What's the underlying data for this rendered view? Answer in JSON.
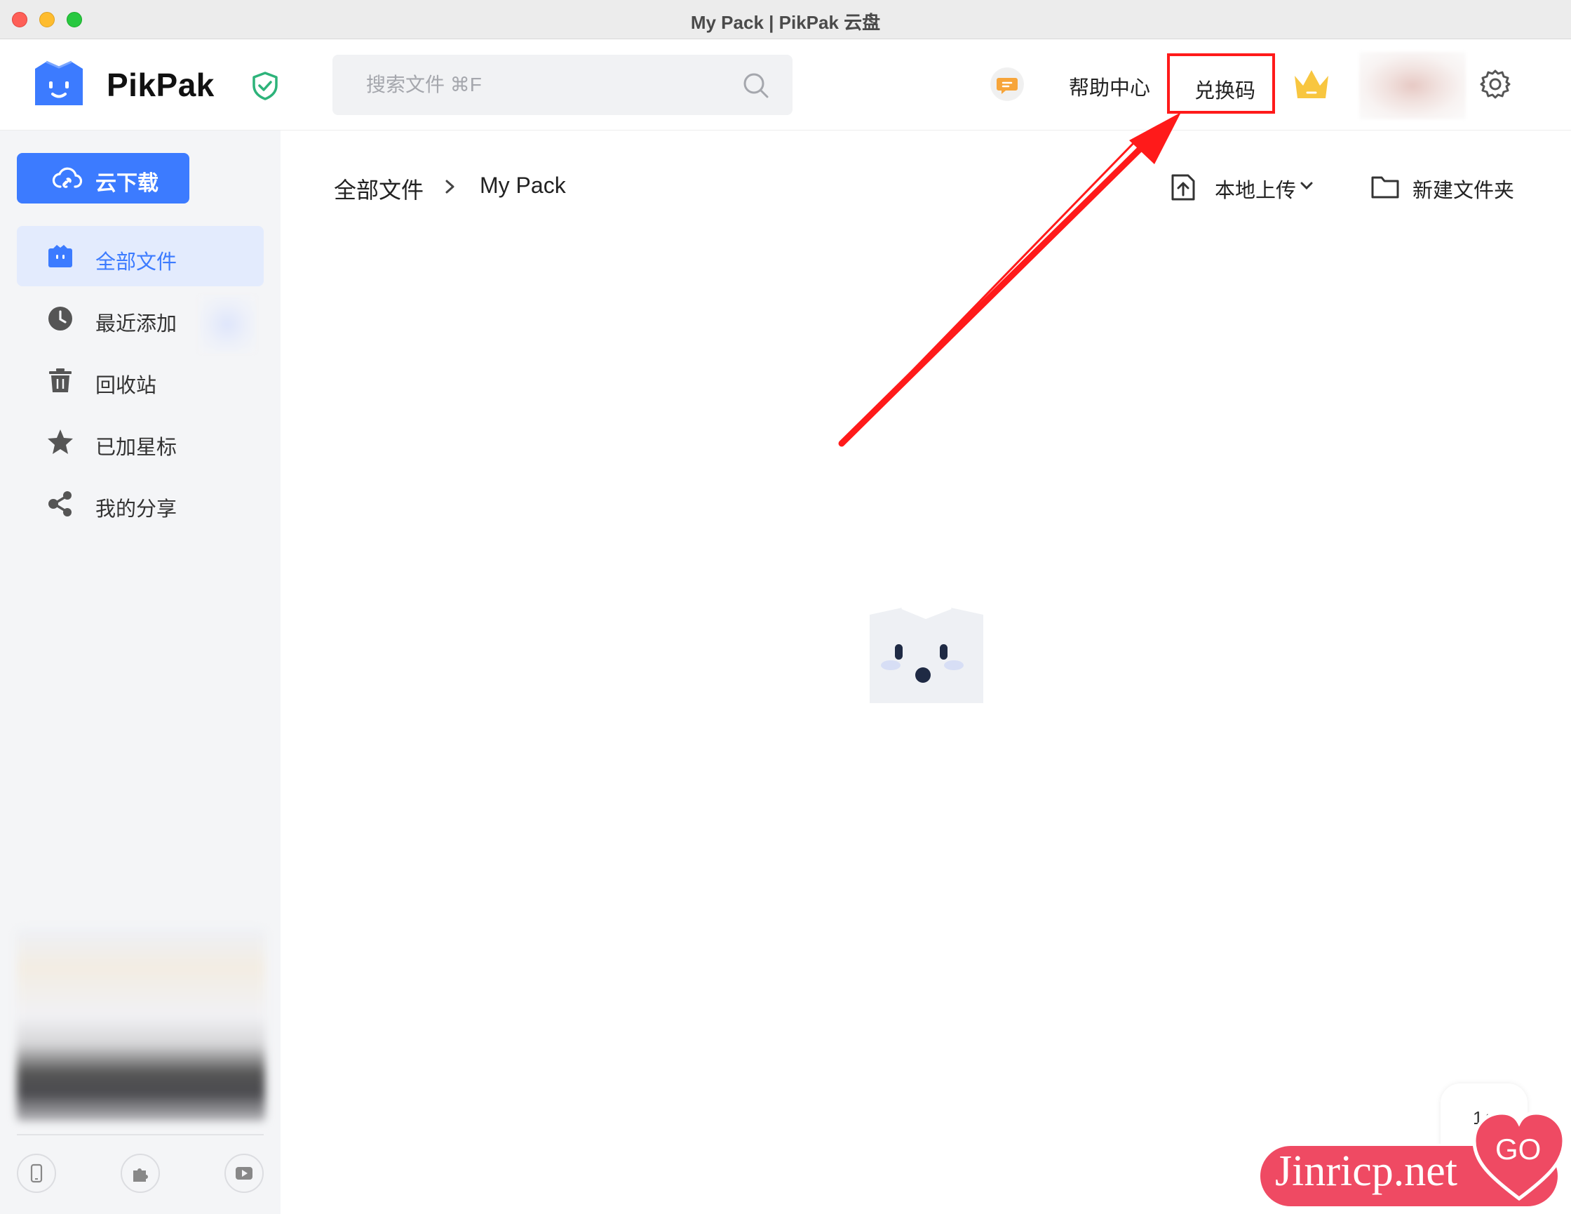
{
  "window": {
    "title": "My Pack | PikPak 云盘"
  },
  "header": {
    "brand": "PikPak",
    "search_placeholder": "搜索文件 ⌘F",
    "help_label": "帮助中心",
    "redeem_label": "兑换码"
  },
  "sidebar": {
    "cloud_download_label": "云下载",
    "items": [
      {
        "label": "全部文件",
        "icon": "box-icon",
        "active": true
      },
      {
        "label": "最近添加",
        "icon": "clock-icon",
        "active": false
      },
      {
        "label": "回收站",
        "icon": "trash-icon",
        "active": false
      },
      {
        "label": "已加星标",
        "icon": "star-icon",
        "active": false
      },
      {
        "label": "我的分享",
        "icon": "share-icon",
        "active": false
      }
    ],
    "bottom_tools": [
      "mobile-icon",
      "plugin-icon",
      "video-icon"
    ]
  },
  "main": {
    "breadcrumb": {
      "root": "全部文件",
      "current": "My Pack"
    },
    "upload_label": "本地上传",
    "new_folder_label": "新建文件夹"
  },
  "scroll_top": {
    "label": "1↑"
  },
  "watermark": {
    "text": "Jinricp.net",
    "badge": "GO"
  },
  "colors": {
    "accent": "#3c7bff",
    "highlight_red": "#ff1a1a",
    "crown": "#f8c640",
    "shield": "#2db37a"
  }
}
